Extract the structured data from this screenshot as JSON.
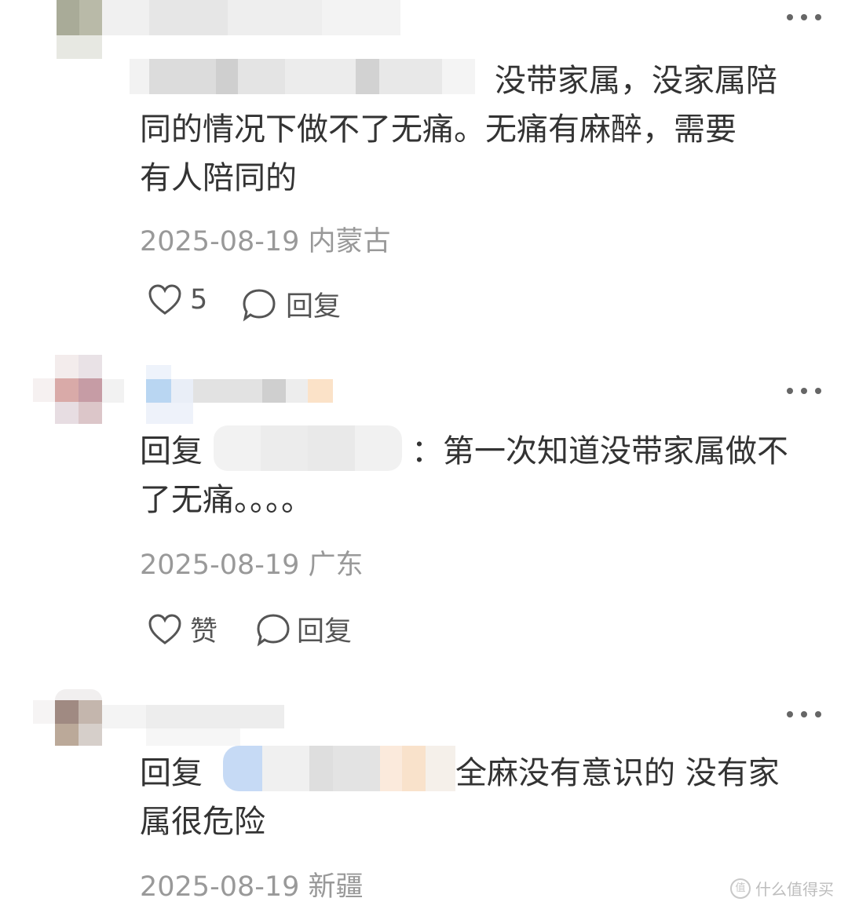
{
  "comments": [
    {
      "reply_prefix": "",
      "text": "没带家属，没家属陪同的情况下做不了无痛。无痛有麻醉，需要有人陪同的",
      "line1": "没带家属，没家属陪",
      "line2": "同的情况下做不了无痛。无痛有麻醉，需要",
      "line3": "有人陪同的",
      "date": "2025-08-19",
      "location": "内蒙古",
      "like_label": "5",
      "reply_label": "回复"
    },
    {
      "reply_prefix": "回复",
      "line1": "：第一次知道没带家属做不",
      "line2": "了无痛。。。。",
      "date": "2025-08-19",
      "location": "广东",
      "like_label": "赞",
      "reply_label": "回复"
    },
    {
      "reply_prefix": "回复",
      "line1": "全麻没有意识的 没有家",
      "line2": "属很危险",
      "date": "2025-08-19",
      "location": "新疆"
    }
  ],
  "watermark": {
    "logo_text": "值",
    "text": "什么值得买"
  },
  "icons": {
    "more": "more-dots-icon",
    "like": "heart-icon",
    "reply": "comment-bubble-icon"
  },
  "colors": {
    "text": "#333333",
    "meta": "#999999"
  }
}
